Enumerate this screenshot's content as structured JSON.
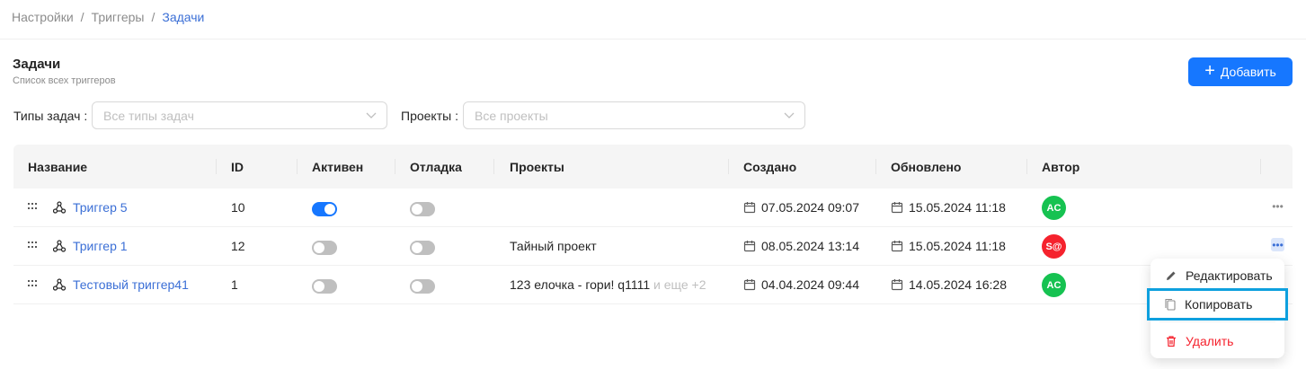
{
  "breadcrumb": {
    "items": [
      "Настройки",
      "Триггеры"
    ],
    "current": "Задачи",
    "separator": "/"
  },
  "page": {
    "title": "Задачи",
    "subtitle": "Список всех триггеров",
    "add_label": "Добавить"
  },
  "filters": {
    "task_types": {
      "label": "Типы задач",
      "placeholder": "Все типы задач"
    },
    "projects": {
      "label": "Проекты",
      "placeholder": "Все проекты"
    }
  },
  "table": {
    "columns": [
      "Название",
      "ID",
      "Активен",
      "Отладка",
      "Проекты",
      "Создано",
      "Обновлено",
      "Автор"
    ],
    "rows": [
      {
        "name": "Триггер 5",
        "id": "10",
        "active": true,
        "debug": false,
        "projects": "",
        "projects_more": "",
        "created": "07.05.2024 09:07",
        "updated": "15.05.2024 11:18",
        "author": "AC",
        "author_color": "#16c251"
      },
      {
        "name": "Триггер 1",
        "id": "12",
        "active": false,
        "debug": false,
        "projects": "Тайный проект",
        "projects_more": "",
        "created": "08.05.2024 13:14",
        "updated": "15.05.2024 11:18",
        "author": "S@",
        "author_color": "#f5222d"
      },
      {
        "name": "Тестовый триггер41",
        "id": "1",
        "active": false,
        "debug": false,
        "projects": "123 елочка - гори! q1111",
        "projects_more": "и еще +2",
        "created": "04.04.2024 09:44",
        "updated": "14.05.2024 16:28",
        "author": "AC",
        "author_color": "#16c251"
      }
    ]
  },
  "context_menu": {
    "edit": "Редактировать",
    "copy": "Копировать",
    "delete": "Удалить"
  },
  "colors": {
    "accent": "#1677ff",
    "link": "#3b6fd6",
    "danger": "#f5222d",
    "highlight": "#0ea0de"
  }
}
